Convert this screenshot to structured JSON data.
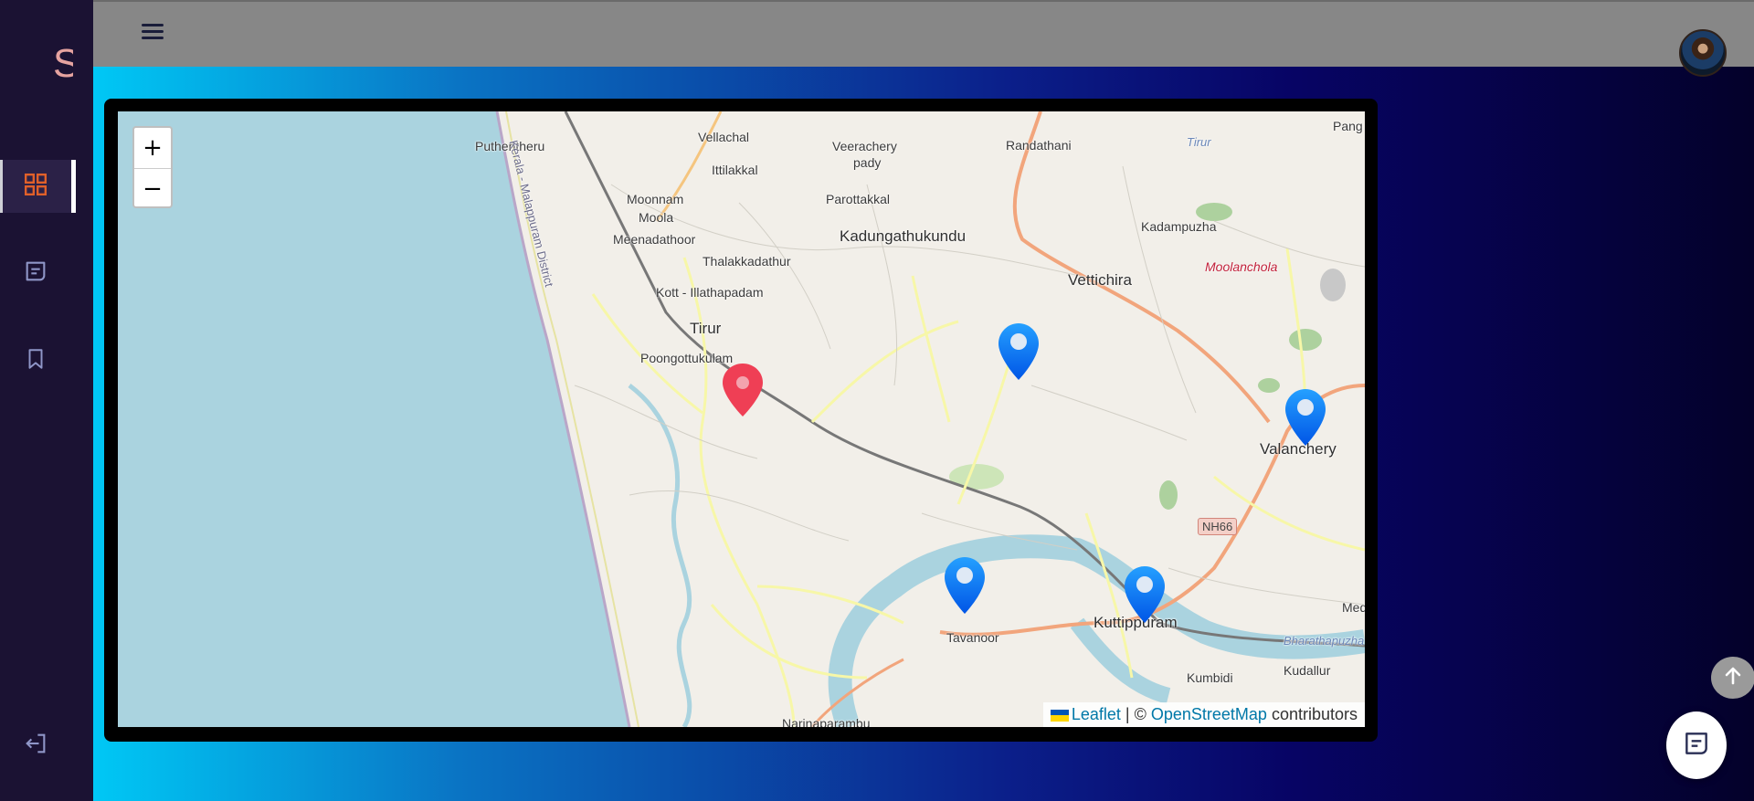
{
  "app": {
    "brand_letter": "S"
  },
  "sidebar": {
    "items": [
      {
        "id": "dashboard",
        "icon": "dashboard-grid-icon",
        "active": true
      },
      {
        "id": "messages",
        "icon": "message-icon",
        "active": false
      },
      {
        "id": "bookmarks",
        "icon": "bookmark-icon",
        "active": false
      }
    ],
    "logout_icon": "logout-icon"
  },
  "header": {
    "menu_icon": "hamburger-icon",
    "avatar": "user-avatar"
  },
  "map": {
    "zoom_in_label": "+",
    "zoom_out_label": "−",
    "labels": {
      "puthentheru": "Puthentheru",
      "vellachal": "Vellachal",
      "veerachery": "Veerachery",
      "pady": "pady",
      "randathani": "Randathani",
      "tirur_top": "Tirur",
      "pang": "Pang",
      "ittilakkal": "Ittilakkal",
      "moonnam": "Moonnam",
      "moola": "Moola",
      "parottakkal": "Parottakkal",
      "meenadathoor": "Meenadathoor",
      "kadungathukundu": "Kadungathukundu",
      "kadampuzha": "Kadampuzha",
      "thalakkadathur": "Thalakkadathur",
      "moolanchola": "Moolanchola",
      "kott_illathapadam": "Kott - Illathapadam",
      "vettichira": "Vettichira",
      "tirur": "Tirur",
      "poongottukulam": "Poongottukulam",
      "valanchery": "Valanchery",
      "nh66": "NH66",
      "tavanoor": "Tavanoor",
      "kuttippuram": "Kuttippuram",
      "kumbidi": "Kumbidi",
      "kudallur": "Kudallur",
      "bharathapuzha": "Bharathapuzha",
      "med": "Med",
      "coast_district": "Kerala - Malappuram District",
      "narippambu": "Narinaparambu"
    },
    "markers": [
      {
        "name": "current-location-marker",
        "color": "#ef3f55"
      },
      {
        "name": "location-marker-vettichira",
        "color": "#1a7cff"
      },
      {
        "name": "location-marker-valanchery",
        "color": "#1a7cff"
      },
      {
        "name": "location-marker-tavanoor",
        "color": "#1a7cff"
      },
      {
        "name": "location-marker-kuttippuram",
        "color": "#1a7cff"
      }
    ],
    "attribution": {
      "leaflet": "Leaflet",
      "separator": "| ©",
      "osm": "OpenStreetMap",
      "contributors": "contributors"
    }
  },
  "floating": {
    "scroll_top_icon": "arrow-up-icon",
    "chat_icon": "chat-icon"
  },
  "colors": {
    "sidebar_bg": "#1b1233",
    "accent_orange": "#e0602a",
    "topbar_bg": "#878787",
    "water": "#aad3df",
    "leaflet_link": "#0078a8"
  }
}
